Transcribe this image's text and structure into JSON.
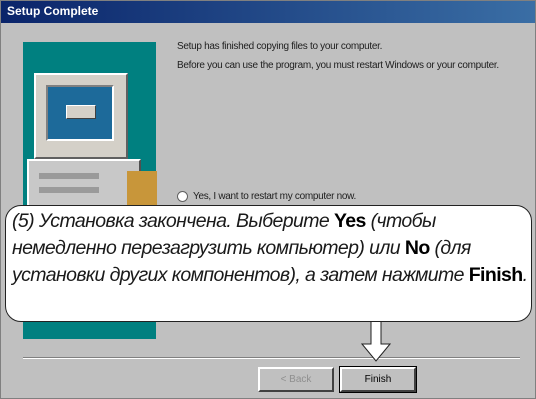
{
  "dialog": {
    "title": "Setup Complete",
    "line1": "Setup has finished copying files to your computer.",
    "line2": "Before you can use the program, you must restart Windows or your computer.",
    "radio_yes": "Yes, I want to restart my computer now."
  },
  "callout": {
    "number": "(5)",
    "t1": "Установка закончена. Выберите ",
    "yes": "Yes",
    "t2": " (чтобы немедленно перезагрузить компьютер) или ",
    "no": "No",
    "t3": " (для установки других компонентов), а затем нажмите ",
    "finish": "Finish",
    "t4": "."
  },
  "buttons": {
    "back": "< Back",
    "finish": "Finish"
  }
}
